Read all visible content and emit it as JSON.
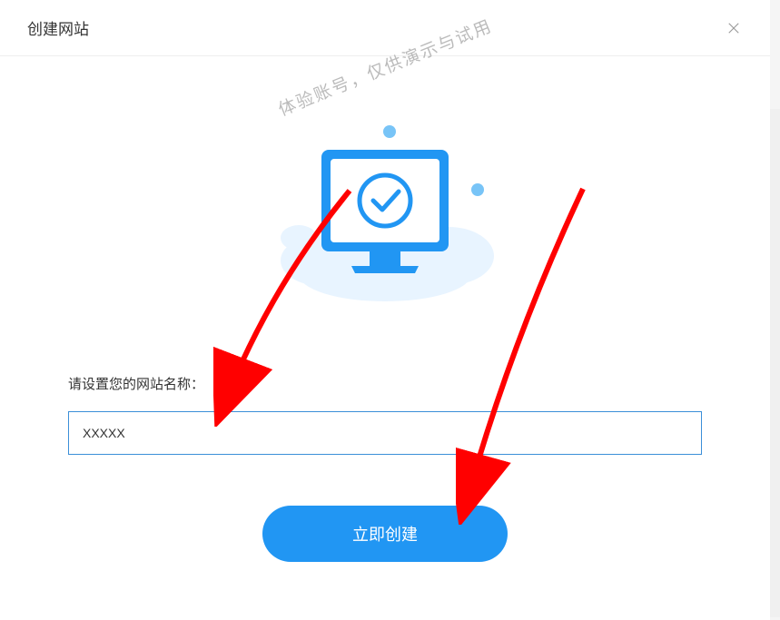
{
  "header": {
    "title": "创建网站"
  },
  "watermark": "体验账号，仅供演示与试用",
  "form": {
    "label": "请设置您的网站名称：",
    "input_value": "XXXXX"
  },
  "button": {
    "create_label": "立即创建"
  }
}
